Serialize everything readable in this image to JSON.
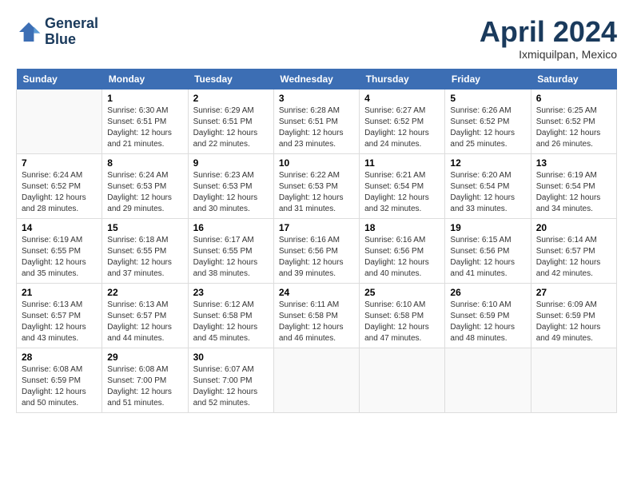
{
  "header": {
    "logo_line1": "General",
    "logo_line2": "Blue",
    "month_title": "April 2024",
    "location": "Ixmiquilpan, Mexico"
  },
  "days_of_week": [
    "Sunday",
    "Monday",
    "Tuesday",
    "Wednesday",
    "Thursday",
    "Friday",
    "Saturday"
  ],
  "weeks": [
    [
      {
        "day": "",
        "info": ""
      },
      {
        "day": "1",
        "info": "Sunrise: 6:30 AM\nSunset: 6:51 PM\nDaylight: 12 hours\nand 21 minutes."
      },
      {
        "day": "2",
        "info": "Sunrise: 6:29 AM\nSunset: 6:51 PM\nDaylight: 12 hours\nand 22 minutes."
      },
      {
        "day": "3",
        "info": "Sunrise: 6:28 AM\nSunset: 6:51 PM\nDaylight: 12 hours\nand 23 minutes."
      },
      {
        "day": "4",
        "info": "Sunrise: 6:27 AM\nSunset: 6:52 PM\nDaylight: 12 hours\nand 24 minutes."
      },
      {
        "day": "5",
        "info": "Sunrise: 6:26 AM\nSunset: 6:52 PM\nDaylight: 12 hours\nand 25 minutes."
      },
      {
        "day": "6",
        "info": "Sunrise: 6:25 AM\nSunset: 6:52 PM\nDaylight: 12 hours\nand 26 minutes."
      }
    ],
    [
      {
        "day": "7",
        "info": "Sunrise: 6:24 AM\nSunset: 6:52 PM\nDaylight: 12 hours\nand 28 minutes."
      },
      {
        "day": "8",
        "info": "Sunrise: 6:24 AM\nSunset: 6:53 PM\nDaylight: 12 hours\nand 29 minutes."
      },
      {
        "day": "9",
        "info": "Sunrise: 6:23 AM\nSunset: 6:53 PM\nDaylight: 12 hours\nand 30 minutes."
      },
      {
        "day": "10",
        "info": "Sunrise: 6:22 AM\nSunset: 6:53 PM\nDaylight: 12 hours\nand 31 minutes."
      },
      {
        "day": "11",
        "info": "Sunrise: 6:21 AM\nSunset: 6:54 PM\nDaylight: 12 hours\nand 32 minutes."
      },
      {
        "day": "12",
        "info": "Sunrise: 6:20 AM\nSunset: 6:54 PM\nDaylight: 12 hours\nand 33 minutes."
      },
      {
        "day": "13",
        "info": "Sunrise: 6:19 AM\nSunset: 6:54 PM\nDaylight: 12 hours\nand 34 minutes."
      }
    ],
    [
      {
        "day": "14",
        "info": "Sunrise: 6:19 AM\nSunset: 6:55 PM\nDaylight: 12 hours\nand 35 minutes."
      },
      {
        "day": "15",
        "info": "Sunrise: 6:18 AM\nSunset: 6:55 PM\nDaylight: 12 hours\nand 37 minutes."
      },
      {
        "day": "16",
        "info": "Sunrise: 6:17 AM\nSunset: 6:55 PM\nDaylight: 12 hours\nand 38 minutes."
      },
      {
        "day": "17",
        "info": "Sunrise: 6:16 AM\nSunset: 6:56 PM\nDaylight: 12 hours\nand 39 minutes."
      },
      {
        "day": "18",
        "info": "Sunrise: 6:16 AM\nSunset: 6:56 PM\nDaylight: 12 hours\nand 40 minutes."
      },
      {
        "day": "19",
        "info": "Sunrise: 6:15 AM\nSunset: 6:56 PM\nDaylight: 12 hours\nand 41 minutes."
      },
      {
        "day": "20",
        "info": "Sunrise: 6:14 AM\nSunset: 6:57 PM\nDaylight: 12 hours\nand 42 minutes."
      }
    ],
    [
      {
        "day": "21",
        "info": "Sunrise: 6:13 AM\nSunset: 6:57 PM\nDaylight: 12 hours\nand 43 minutes."
      },
      {
        "day": "22",
        "info": "Sunrise: 6:13 AM\nSunset: 6:57 PM\nDaylight: 12 hours\nand 44 minutes."
      },
      {
        "day": "23",
        "info": "Sunrise: 6:12 AM\nSunset: 6:58 PM\nDaylight: 12 hours\nand 45 minutes."
      },
      {
        "day": "24",
        "info": "Sunrise: 6:11 AM\nSunset: 6:58 PM\nDaylight: 12 hours\nand 46 minutes."
      },
      {
        "day": "25",
        "info": "Sunrise: 6:10 AM\nSunset: 6:58 PM\nDaylight: 12 hours\nand 47 minutes."
      },
      {
        "day": "26",
        "info": "Sunrise: 6:10 AM\nSunset: 6:59 PM\nDaylight: 12 hours\nand 48 minutes."
      },
      {
        "day": "27",
        "info": "Sunrise: 6:09 AM\nSunset: 6:59 PM\nDaylight: 12 hours\nand 49 minutes."
      }
    ],
    [
      {
        "day": "28",
        "info": "Sunrise: 6:08 AM\nSunset: 6:59 PM\nDaylight: 12 hours\nand 50 minutes."
      },
      {
        "day": "29",
        "info": "Sunrise: 6:08 AM\nSunset: 7:00 PM\nDaylight: 12 hours\nand 51 minutes."
      },
      {
        "day": "30",
        "info": "Sunrise: 6:07 AM\nSunset: 7:00 PM\nDaylight: 12 hours\nand 52 minutes."
      },
      {
        "day": "",
        "info": ""
      },
      {
        "day": "",
        "info": ""
      },
      {
        "day": "",
        "info": ""
      },
      {
        "day": "",
        "info": ""
      }
    ]
  ]
}
